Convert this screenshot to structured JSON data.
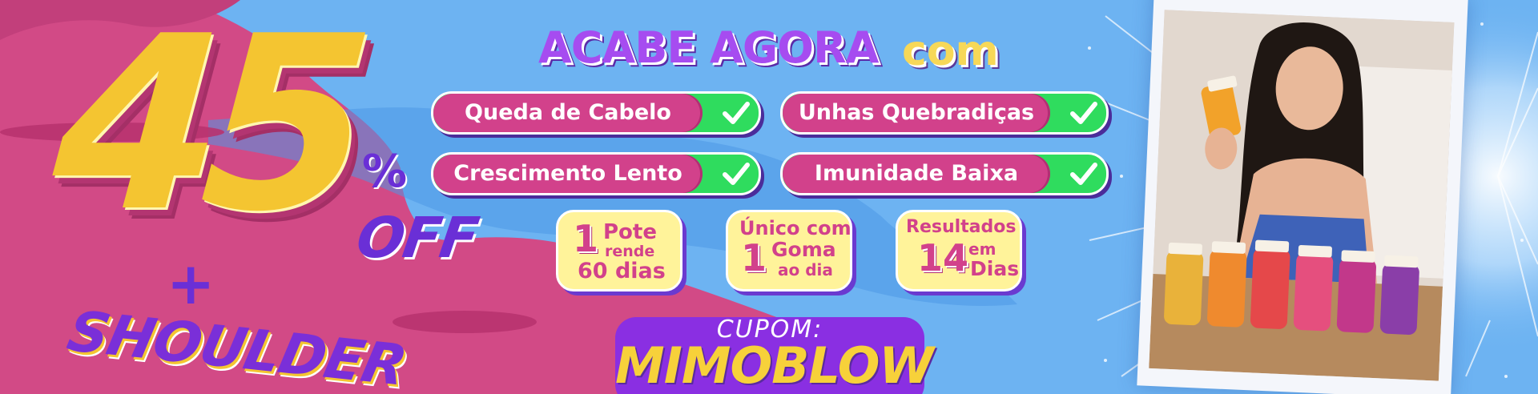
{
  "colors": {
    "magenta": "#d24a86",
    "sky_blue": "#6db3f2",
    "yellow": "#f4c531",
    "purple": "#7a2fd8",
    "green": "#2fdc5e",
    "pale_yellow": "#fff39a"
  },
  "promo": {
    "discount_number": "45",
    "percent_sign": "%",
    "off_label": "OFF",
    "plus_sign": "+",
    "bonus_label": "SHOULDER"
  },
  "headline": {
    "main": "ACABE AGORA",
    "sub": "com"
  },
  "benefits": [
    {
      "label": "Queda de Cabelo",
      "icon": "check-icon"
    },
    {
      "label": "Unhas Quebradiças",
      "icon": "check-icon"
    },
    {
      "label": "Crescimento Lento",
      "icon": "check-icon"
    },
    {
      "label": "Imunidade Baixa",
      "icon": "check-icon"
    }
  ],
  "info_boxes": [
    {
      "number": "1",
      "line1": "Pote",
      "line2": "rende",
      "line3": "60 dias"
    },
    {
      "line1": "Único com",
      "number": "1",
      "line2": "Goma",
      "line3": "ao dia"
    },
    {
      "line1": "Resultados",
      "number": "14",
      "line2": "em",
      "line3": "Dias"
    }
  ],
  "coupon": {
    "label": "CUPOM:",
    "code": "MIMOBLOW"
  }
}
